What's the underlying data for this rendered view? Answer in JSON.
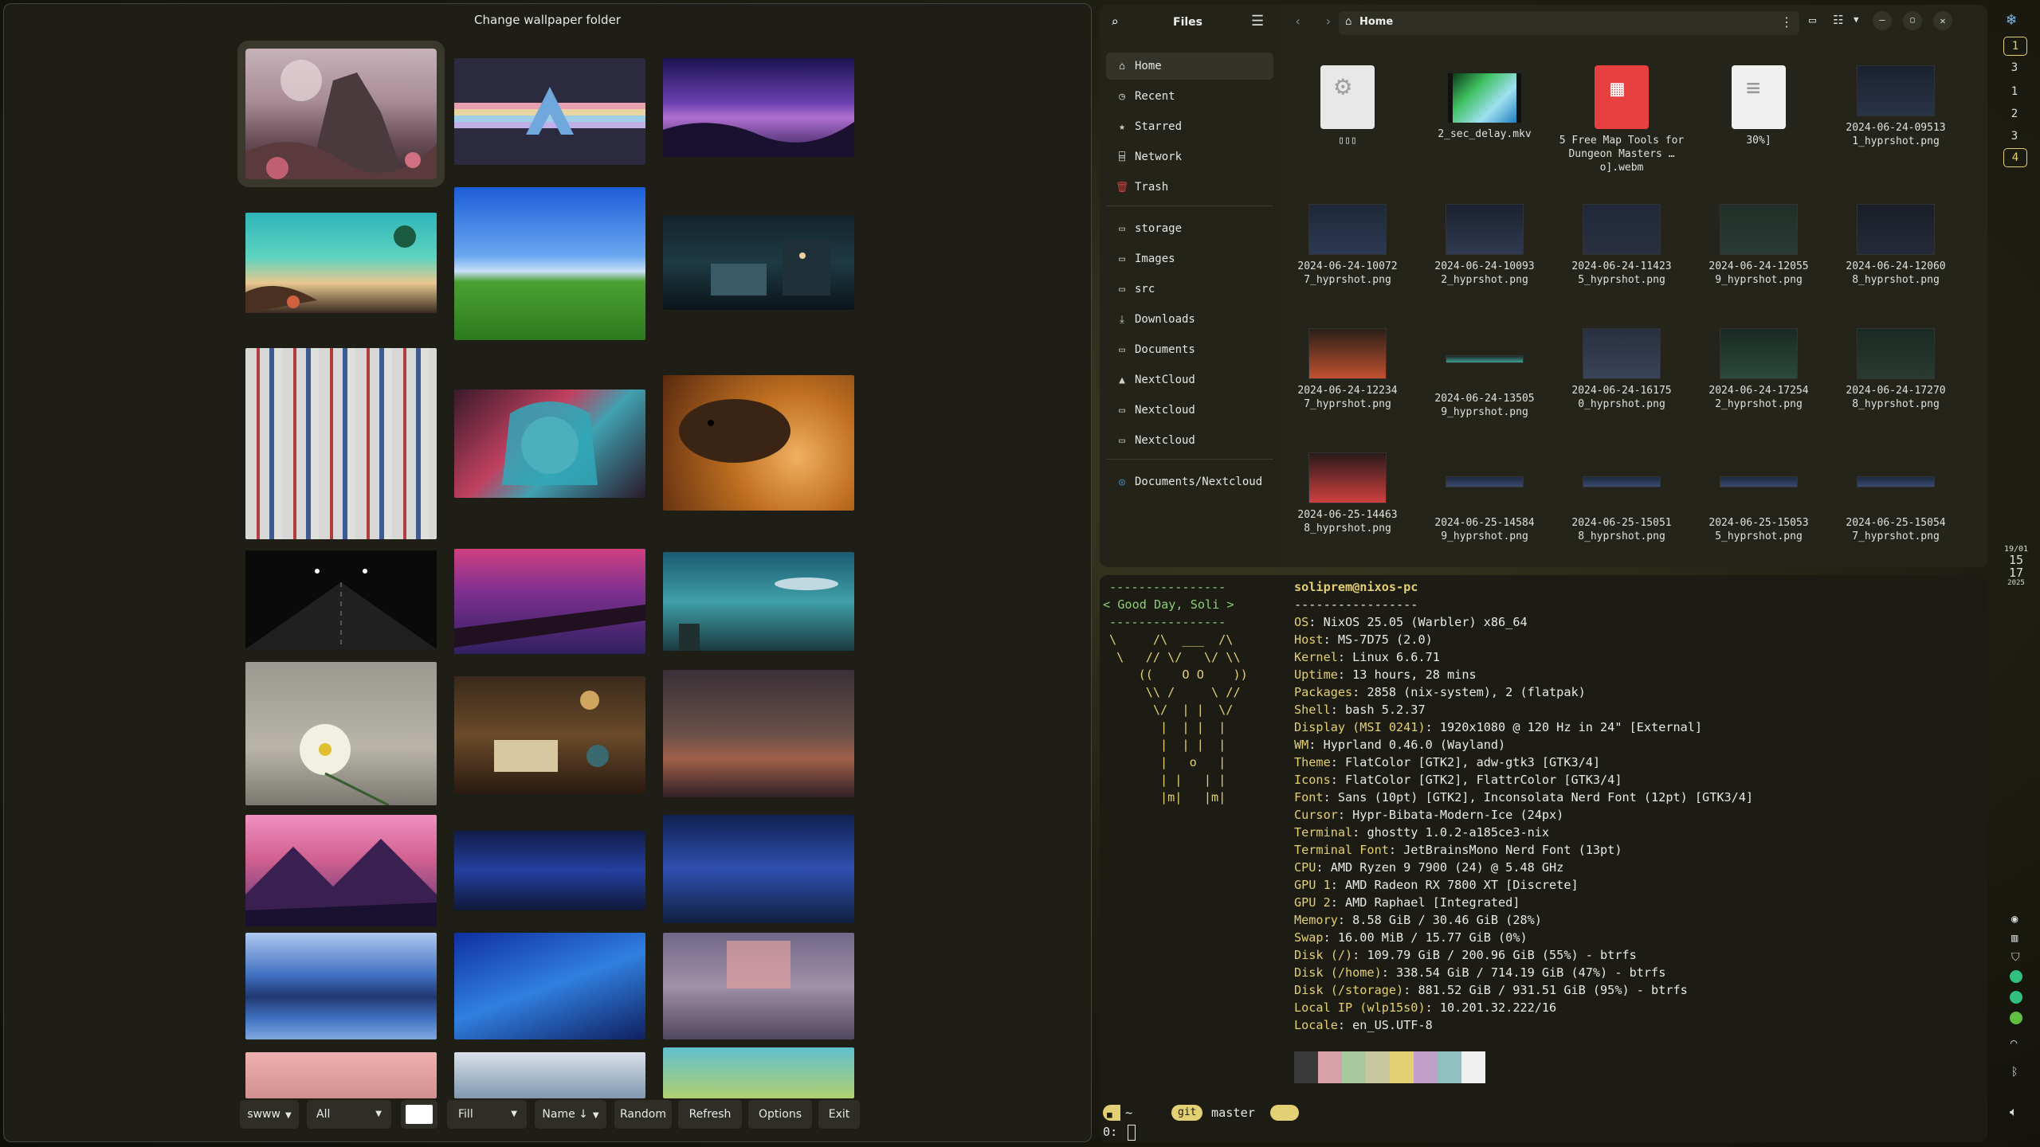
{
  "wallpaper_picker": {
    "title": "Change wallpaper folder",
    "controls": {
      "backend": "swww",
      "monitor": "All",
      "fill_mode": "Fill",
      "sort": "Name ↓",
      "random": "Random",
      "refresh": "Refresh",
      "options": "Options",
      "exit": "Exit"
    }
  },
  "files": {
    "app_title": "Files",
    "path": "Home",
    "sidebar": [
      {
        "icon": "home-icon",
        "label": "Home"
      },
      {
        "icon": "clock-icon",
        "label": "Recent"
      },
      {
        "icon": "star-icon",
        "label": "Starred"
      },
      {
        "icon": "network-icon",
        "label": "Network"
      },
      {
        "icon": "trash-icon",
        "label": "Trash"
      },
      {
        "icon": "folder-icon",
        "label": "storage"
      },
      {
        "icon": "folder-icon",
        "label": "Images"
      },
      {
        "icon": "folder-icon",
        "label": "src"
      },
      {
        "icon": "download-icon",
        "label": "Downloads"
      },
      {
        "icon": "folder-icon",
        "label": "Documents"
      },
      {
        "icon": "warning-icon",
        "label": "NextCloud"
      },
      {
        "icon": "folder-icon",
        "label": "Nextcloud"
      },
      {
        "icon": "folder-icon",
        "label": "Nextcloud"
      },
      {
        "icon": "nextcloud-icon",
        "label": "Documents/Nextcloud"
      }
    ],
    "items": [
      {
        "name": "▯▯▯"
      },
      {
        "name": "2_sec_delay.mkv"
      },
      {
        "name": "5 Free Map Tools for Dungeon Masters …o].webm"
      },
      {
        "name": "30%]"
      },
      {
        "name": "2024-06-24-09513 1_hyprshot.png"
      },
      {
        "name": "2024-06-24-10072 7_hyprshot.png"
      },
      {
        "name": "2024-06-24-10093 2_hyprshot.png"
      },
      {
        "name": "2024-06-24-11423 5_hyprshot.png"
      },
      {
        "name": "2024-06-24-12055 9_hyprshot.png"
      },
      {
        "name": "2024-06-24-12060 8_hyprshot.png"
      },
      {
        "name": "2024-06-24-12234 7_hyprshot.png"
      },
      {
        "name": "2024-06-24-13505 9_hyprshot.png"
      },
      {
        "name": "2024-06-24-16175 0_hyprshot.png"
      },
      {
        "name": "2024-06-24-17254 2_hyprshot.png"
      },
      {
        "name": "2024-06-24-17270 8_hyprshot.png"
      },
      {
        "name": "2024-06-25-14463 8_hyprshot.png"
      },
      {
        "name": "2024-06-25-14584 9_hyprshot.png"
      },
      {
        "name": "2024-06-25-15051 8_hyprshot.png"
      },
      {
        "name": "2024-06-25-15053 5_hyprshot.png"
      },
      {
        "name": "2024-06-25-15054 7_hyprshot.png"
      }
    ]
  },
  "terminal": {
    "cow": [
      "----------------",
      "< Good Day, Soli >",
      "----------------",
      "\\     /\\  ___  /\\",
      " \\   // \\/   \\/ \\\\",
      "    ((    O O    ))",
      "     \\\\ /     \\ //",
      "      \\/  | |  \\/",
      "       |  | |  |",
      "       |  | |  |",
      "       |   o   |",
      "       | |   | |",
      "       |m|   |m|"
    ],
    "user_host": "soliprem@nixos-pc",
    "separator": "-----------------",
    "info": [
      {
        "k": "OS",
        "v": "NixOS 25.05 (Warbler) x86_64"
      },
      {
        "k": "Host",
        "v": "MS-7D75 (2.0)"
      },
      {
        "k": "Kernel",
        "v": "Linux 6.6.71"
      },
      {
        "k": "Uptime",
        "v": "13 hours, 28 mins"
      },
      {
        "k": "Packages",
        "v": "2858 (nix-system), 2 (flatpak)"
      },
      {
        "k": "Shell",
        "v": "bash 5.2.37"
      },
      {
        "k": "Display (MSI 0241)",
        "v": "1920x1080 @ 120 Hz in 24\" [External]"
      },
      {
        "k": "WM",
        "v": "Hyprland 0.46.0 (Wayland)"
      },
      {
        "k": "Theme",
        "v": "FlatColor [GTK2], adw-gtk3 [GTK3/4]"
      },
      {
        "k": "Icons",
        "v": "FlatColor [GTK2], FlattrColor [GTK3/4]"
      },
      {
        "k": "Font",
        "v": "Sans (10pt) [GTK2], Inconsolata Nerd Font (12pt) [GTK3/4]"
      },
      {
        "k": "Cursor",
        "v": "Hypr-Bibata-Modern-Ice (24px)"
      },
      {
        "k": "Terminal",
        "v": "ghostty 1.0.2-a185ce3-nix"
      },
      {
        "k": "Terminal Font",
        "v": "JetBrainsMono Nerd Font (13pt)"
      },
      {
        "k": "CPU",
        "v": "AMD Ryzen 9 7900 (24) @ 5.48 GHz"
      },
      {
        "k": "GPU 1",
        "v": "AMD Radeon RX 7800 XT [Discrete]"
      },
      {
        "k": "GPU 2",
        "v": "AMD Raphael [Integrated]"
      },
      {
        "k": "Memory",
        "v": "8.58 GiB / 30.46 GiB (28%)"
      },
      {
        "k": "Swap",
        "v": "16.00 MiB / 15.77 GiB (0%)"
      },
      {
        "k": "Disk (/)",
        "v": "109.79 GiB / 200.96 GiB (55%) - btrfs"
      },
      {
        "k": "Disk (/home)",
        "v": "338.54 GiB / 714.19 GiB (47%) - btrfs"
      },
      {
        "k": "Disk (/storage)",
        "v": "881.52 GiB / 931.51 GiB (95%) - btrfs"
      },
      {
        "k": "Local IP (wlp15s0)",
        "v": "10.201.32.222/16"
      },
      {
        "k": "Locale",
        "v": "en_US.UTF-8"
      }
    ],
    "palette": [
      "#3a3a3a",
      "#d8a0a8",
      "#a8c8a0",
      "#c8c8a0",
      "#e3cf74",
      "#c0a0c8",
      "#90c0c0",
      "#f0f0f0"
    ],
    "prompt": {
      "dir": "~",
      "git_label": "git",
      "branch": "master",
      "line2": "0:"
    }
  },
  "status_bar": {
    "workspaces": [
      "1",
      "3",
      "1",
      "2",
      "3",
      "4"
    ],
    "date": "19/01",
    "time_h": "15",
    "time_m": "17",
    "year": "2025"
  }
}
